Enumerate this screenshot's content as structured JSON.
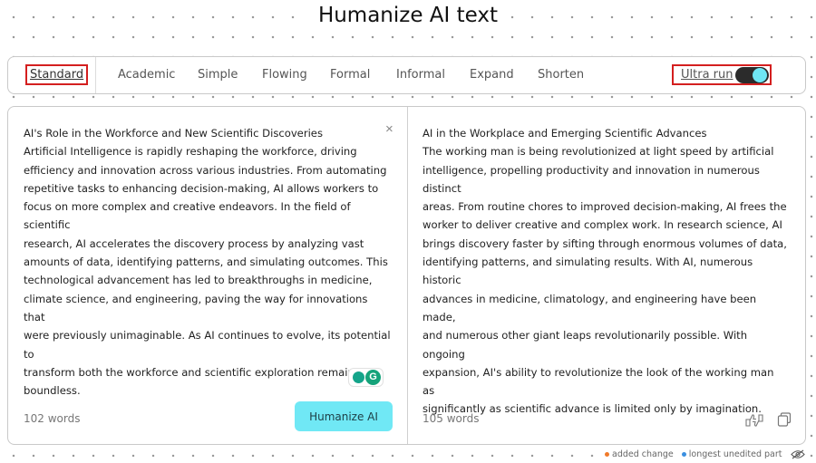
{
  "page": {
    "title": "Humanize AI text"
  },
  "modes": {
    "items": [
      {
        "label": "Standard",
        "active": true
      },
      {
        "label": "Academic",
        "active": false
      },
      {
        "label": "Simple",
        "active": false
      },
      {
        "label": "Flowing",
        "active": false
      },
      {
        "label": "Formal",
        "active": false
      },
      {
        "label": "Informal",
        "active": false
      },
      {
        "label": "Expand",
        "active": false
      },
      {
        "label": "Shorten",
        "active": false
      }
    ],
    "ultra_run_label": "Ultra run",
    "ultra_run_on": true
  },
  "input": {
    "lines": [
      "AI's Role in the Workforce and New Scientific Discoveries",
      "Artificial Intelligence is rapidly reshaping the workforce, driving",
      "efficiency and innovation across various industries. From automating",
      "repetitive tasks to enhancing decision-making, AI allows workers to",
      "focus on more complex and creative endeavors. In the field of scientific",
      "research, AI accelerates the discovery process by analyzing vast",
      "amounts of data, identifying patterns, and simulating outcomes. This",
      "technological advancement has led to breakthroughs in medicine,",
      "climate science, and engineering, paving the way for innovations that",
      "were previously unimaginable. As AI continues to evolve, its potential to",
      "transform both the workforce and scientific exploration remains",
      "boundless."
    ],
    "word_count": "102 words",
    "humanize_label": "Humanize AI",
    "close_glyph": "×",
    "grammarly_glyph": "G"
  },
  "output": {
    "lines": [
      "AI in the Workplace and Emerging Scientific Advances",
      "The working man is being revolutionized at light speed by artificial",
      "intelligence, propelling productivity and innovation in numerous distinct",
      "areas. From routine chores to improved decision-making, AI frees the",
      "worker to deliver creative and complex work. In research science, AI",
      "brings discovery faster by sifting through enormous volumes of data,",
      "identifying patterns, and simulating results. With AI, numerous historic",
      "advances in medicine, climatology, and engineering have been made,",
      "and numerous other giant leaps revolutionarily possible. With ongoing",
      "expansion, AI's ability to revolutionize the look of the working man as",
      "significantly as scientific advance is limited only by imagination."
    ],
    "word_count": "105 words"
  },
  "legend": {
    "added_change": "added change",
    "longest_unedited": "longest unedited part",
    "added_color": "#f07a2a",
    "unedited_color": "#3b8fe0"
  },
  "colors": {
    "accent": "#70e8f5",
    "highlight_border": "#d41f1f",
    "toggle_track": "#2b2b2b"
  },
  "icons": [
    "close-icon",
    "grammarly-icon",
    "feedback-icon",
    "copy-icon",
    "eye-off-icon"
  ]
}
